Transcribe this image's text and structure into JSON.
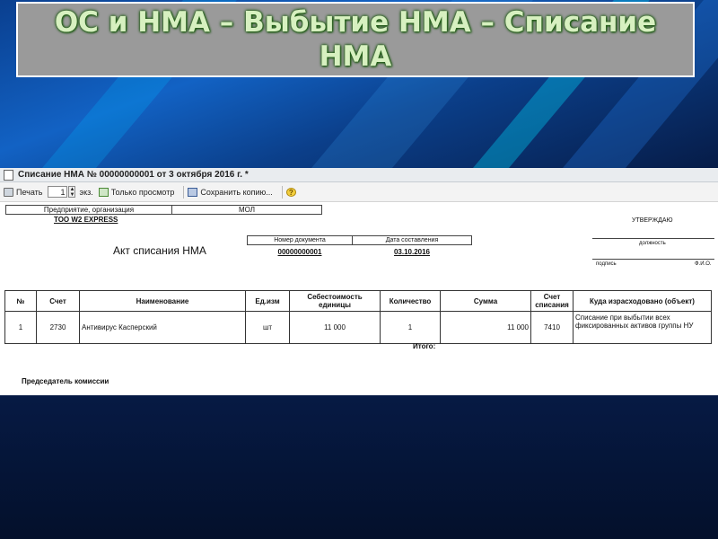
{
  "slide": {
    "title": "ОС и НМА – Выбытие НМА – Списание НМА"
  },
  "window": {
    "title": "Списание НМА № 00000000001 от 3 октября 2016 г. *"
  },
  "toolbar": {
    "print_label": "Печать",
    "copies_value": "1",
    "copies_unit": "экз.",
    "view_only_label": "Только просмотр",
    "save_copy_label": "Сохранить копию...",
    "help_label": "?"
  },
  "form": {
    "org_header": "Предприятие, организация",
    "mol_header": "МОЛ",
    "company": "ТОО W2 EXPRESS",
    "act_title": "Акт списания НМА",
    "doc_number_header": "Номер документа",
    "doc_date_header": "Дата составления",
    "doc_number": "00000000001",
    "doc_date": "03.10.2016",
    "approve": "УТВЕРЖДАЮ",
    "position_label": "должность",
    "signature_label": "подпись",
    "name_label": "Ф.И.О.",
    "total_label": "Итого:",
    "chairman_label": "Председатель комиссии"
  },
  "table": {
    "columns": [
      "№",
      "Счет",
      "Наименование",
      "Ед.изм",
      "Себестоимость единицы",
      "Количество",
      "Сумма",
      "Счет списания",
      "Куда израсходовано (объект)"
    ],
    "rows": [
      [
        "1",
        "2730",
        "Антивирус Касперский",
        "шт",
        "11 000",
        "1",
        "11 000",
        "7410",
        "Списание при выбытии всех фиксированных активов группы НУ"
      ]
    ]
  }
}
